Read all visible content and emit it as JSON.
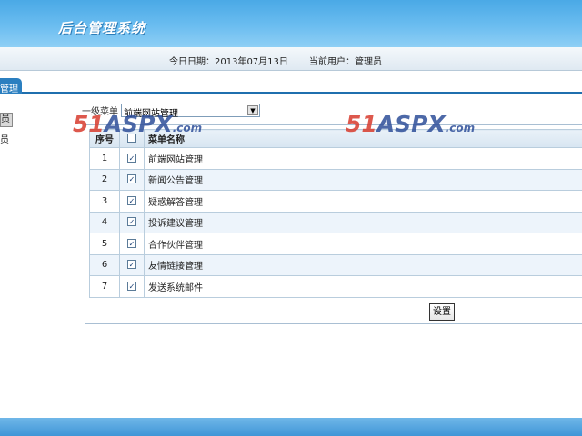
{
  "header": {
    "title": "后台管理系统"
  },
  "infobar": {
    "date_text": "今日日期：2013年07月13日",
    "user_text": "当前用户：管理员"
  },
  "tab": {
    "label": "管理"
  },
  "sidebar": {
    "items": [
      {
        "label": "员"
      },
      {
        "label": "员"
      }
    ]
  },
  "menu": {
    "label": "一级菜单",
    "selected": "前端网站管理"
  },
  "table": {
    "headers": {
      "index": "序号",
      "name": "菜单名称"
    },
    "rows": [
      {
        "index": "1",
        "name": "前端网站管理",
        "checked": true
      },
      {
        "index": "2",
        "name": "新闻公告管理",
        "checked": true
      },
      {
        "index": "3",
        "name": "疑惑解答管理",
        "checked": true
      },
      {
        "index": "4",
        "name": "投诉建议管理",
        "checked": true
      },
      {
        "index": "5",
        "name": "合作伙伴管理",
        "checked": true
      },
      {
        "index": "6",
        "name": "友情链接管理",
        "checked": true
      },
      {
        "index": "7",
        "name": "发送系统邮件",
        "checked": true
      }
    ]
  },
  "actions": {
    "set_label": "设置"
  },
  "watermark": {
    "part1": "51",
    "part2": "ASPX",
    "part3": ".com"
  },
  "colors": {
    "banner": "#4aa9e6",
    "tab": "#2b7fc0",
    "watermark_red": "#d83c2e",
    "watermark_blue": "#2f4f9a"
  }
}
